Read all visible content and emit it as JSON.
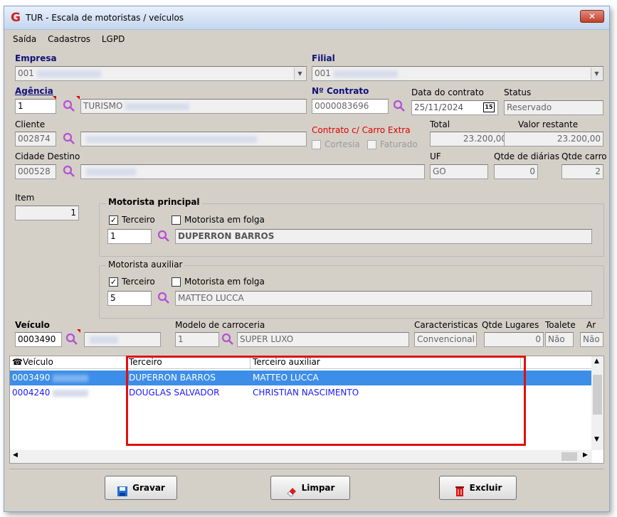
{
  "window": {
    "title": "TUR - Escala de motoristas / veículos",
    "close_label": "✕"
  },
  "menu": [
    "Saída",
    "Cadastros",
    "LGPD"
  ],
  "labels": {
    "empresa": "Empresa",
    "filial": "Filial",
    "agencia": "Agência",
    "contrato": "Nº Contrato",
    "data_contrato": "Data do contrato",
    "status": "Status",
    "cliente": "Cliente",
    "contrato_extra": "Contrato c/ Carro Extra",
    "total": "Total",
    "valor_restante": "Valor restante",
    "cortesia": "Cortesia",
    "faturado": "Faturado",
    "cidade_destino": "Cidade Destino",
    "uf": "UF",
    "qtde_diarias": "Qtde de diárias",
    "qtde_carro": "Qtde carro",
    "item": "Item",
    "motorista_principal": "Motorista principal",
    "motorista_auxiliar": "Motorista auxiliar",
    "terceiro": "Terceiro",
    "motorista_folga": "Motorista em folga",
    "veiculo": "Veículo",
    "modelo_carroceria": "Modelo de carroceria",
    "caracteristicas": "Caracteristicas",
    "qtde_lugares": "Qtde Lugares",
    "toalete": "Toalete",
    "ar": "Ar"
  },
  "fields": {
    "empresa": "001",
    "filial": "001",
    "agencia": "1",
    "agencia_desc": "TURISMO",
    "contrato": "0000083696",
    "data_contrato": "25/11/2024",
    "calendar": "15",
    "status": "Reservado",
    "cliente": "002874",
    "total": "23.200,00",
    "valor_restante": "23.200,00",
    "cidade_destino": "000528",
    "uf": "GO",
    "qtde_diarias": "0",
    "qtde_carro": "2",
    "item": "1",
    "motorista_principal_cod": "1",
    "motorista_principal_nome": "DUPERRON BARROS",
    "motorista_auxiliar_cod": "5",
    "motorista_auxiliar_nome": "MATTEO LUCCA",
    "veiculo": "0003490",
    "modelo_cod": "1",
    "modelo_nome": "SUPER LUXO",
    "caracteristicas": "Convencional",
    "qtde_lugares": "0",
    "toalete": "Não",
    "ar": "Não"
  },
  "checks": {
    "principal_terceiro": true,
    "principal_folga": false,
    "auxiliar_terceiro": true,
    "auxiliar_folga": false,
    "cortesia": false,
    "faturado": false
  },
  "grid": {
    "headers": [
      "Veículo",
      "Terceiro",
      "Terceiro auxiliar"
    ],
    "rows": [
      {
        "veiculo": "0003490",
        "terceiro": "DUPERRON BARROS",
        "auxiliar": "MATTEO LUCCA"
      },
      {
        "veiculo": "0004240",
        "terceiro": "DOUGLAS SALVADOR",
        "auxiliar": "CHRISTIAN NASCIMENTO"
      }
    ]
  },
  "buttons": {
    "gravar": "Gravar",
    "limpar": "Limpar",
    "excluir": "Excluir"
  }
}
